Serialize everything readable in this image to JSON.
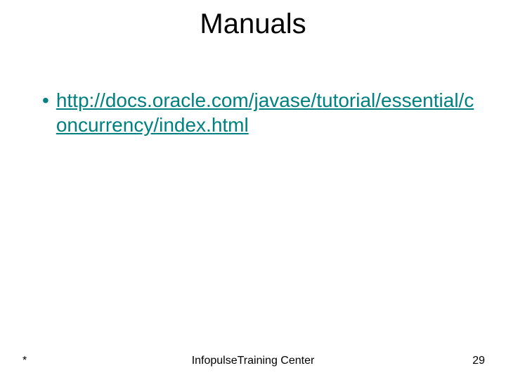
{
  "title": "Manuals",
  "bullet": "•",
  "link_text": "http://docs.oracle.com/javase/tutorial/essential/concurrency/index.html",
  "footer": {
    "left": "*",
    "center": "InfopulseTraining Center",
    "right": "29"
  }
}
